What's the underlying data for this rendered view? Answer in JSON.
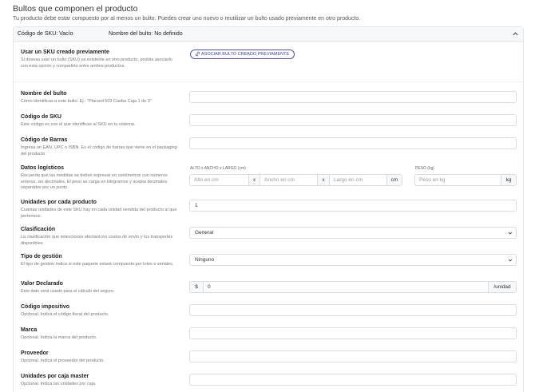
{
  "page": {
    "title": "Bultos que componen el producto",
    "subtitle": "Tu producto debe estar compuesto por al menos un bulto. Puedes crear uno nuevo o reutilizar un bulto usado previamente en otro producto."
  },
  "card_header": {
    "sku": "Código de SKU: Vacío",
    "name": "Nombre del bulto: No definido",
    "chevron_icon": "chevron-up-icon"
  },
  "reuse": {
    "title": "Usar un SKU creado previamente",
    "desc": "Si deseas usar un bulto (SKU) ya existente en otro producto, podrás asociarlo con esta opción y compartirlo entre ambos productos.",
    "button": "ASOCIAR BULTO CREADO PREVIAMENTE",
    "button_icon": "link-icon"
  },
  "fields": {
    "nombre": {
      "title": "Nombre del bulto",
      "desc": "Cómo identificas a este bulto. Ej.: \"Placard 503 Caoba Caja 1 de 3\"",
      "value": ""
    },
    "sku": {
      "title": "Código de SKU",
      "desc": "Este código es con el que identificas al SKU en tu sistema.",
      "value": ""
    },
    "barras": {
      "title": "Código de Barras",
      "desc": "Ingresa un EAN, UPC o ISBN. Es el código de barras que viene en el packaging del producto.",
      "value": ""
    },
    "logisticos": {
      "title": "Datos logísticos",
      "desc": "Recuerda que las medidas se deben expresar en centímetros con números enteros, sin decimales. El peso se carga en kilogramos y acepta decimales separados por un punto.",
      "dims_label": "ALTO x ANCHO x LARGO (cm)",
      "alto_placeholder": "Alto en cm",
      "ancho_placeholder": "Ancho en cm",
      "largo_placeholder": "Largo en cm",
      "sep": "x",
      "dim_unit": "cm",
      "peso_label": "PESO (kg)",
      "peso_placeholder": "Peso en kg",
      "peso_unit": "kg"
    },
    "unidades": {
      "title": "Unidades por cada producto",
      "desc": "Cuántas unidades de este SKU hay en cada unidad vendida del producto al que pertenece.",
      "value": "1"
    },
    "clasificacion": {
      "title": "Clasificación",
      "desc": "La clasificación que selecciones afectará los costos de envío y los transportes disponibles.",
      "value": "General"
    },
    "gestion": {
      "title": "Tipo de gestión",
      "desc": "El tipo de gestión indica si este paquete estará compuesto por lotes o seriales.",
      "value": "Ninguno"
    },
    "valor": {
      "title": "Valor Declarado",
      "desc": "Este dato será usado para el cálculo del seguro.",
      "currency": "$",
      "value": "0",
      "suffix": "/unidad"
    },
    "impositivo": {
      "title": "Código impositivo",
      "desc": "Opcional. Indica el código fiscal del producto.",
      "value": ""
    },
    "marca": {
      "title": "Marca",
      "desc": "Opcional. Indica la marca del producto.",
      "value": ""
    },
    "proveedor": {
      "title": "Proveedor",
      "desc": "Opcional. Indica el proveedor del producto.",
      "value": ""
    },
    "master": {
      "title": "Unidades por caja master",
      "desc": "Opcional. Indica las unidades por caja.",
      "value": ""
    }
  }
}
